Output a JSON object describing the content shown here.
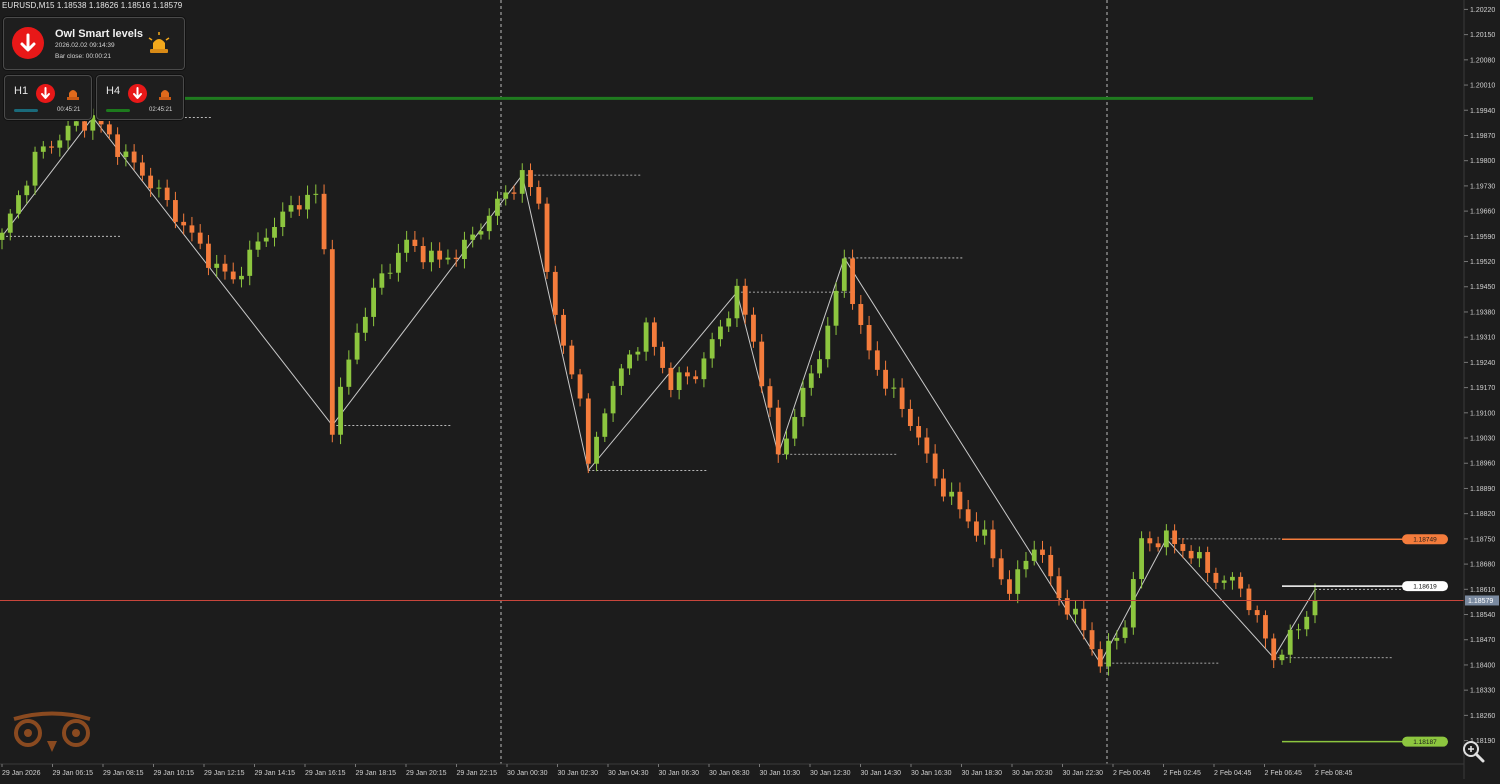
{
  "symbol_info": "EURUSD,M15  1.18538  1.18626  1.18516  1.18579",
  "indicator_panel": {
    "title": "Owl Smart levels",
    "datetime": "2026.02.02 09:14:39",
    "bar_close": "Bar close: 00:00:21",
    "signal": "down",
    "signal_color": "#e81818"
  },
  "timeframes": [
    {
      "label": "H1",
      "signal": "down",
      "time": "00:45:21",
      "bar_color": "#1a6a7a"
    },
    {
      "label": "H4",
      "signal": "down",
      "time": "02:45:21",
      "bar_color": "#1d7a1d"
    }
  ],
  "icons": {
    "main": "arrow-down-icon",
    "alarm": "alarm-siren-icon",
    "zoom": "magnifier-icon",
    "logo": "owl-logo-icon"
  },
  "colors": {
    "background": "#1c1c1c",
    "bull": "#8dc63f",
    "bear": "#f47c3c",
    "zigzag": "#e8e8e8",
    "bid_line": "#c8463c",
    "resistance": "#1f7a1f",
    "axis_text": "#d0d0d0"
  },
  "chart_data": {
    "type": "candlestick",
    "symbol": "EURUSD",
    "timeframe": "M15",
    "ohlc_last": {
      "open": 1.18538,
      "high": 1.18626,
      "low": 1.18516,
      "close": 1.18579
    },
    "y_axis": {
      "range": [
        1.18125,
        1.20235
      ],
      "ticks": [
        "1.20220",
        "1.20150",
        "1.20080",
        "1.20010",
        "1.19940",
        "1.19870",
        "1.19800",
        "1.19730",
        "1.19660",
        "1.19590",
        "1.19520",
        "1.19450",
        "1.19380",
        "1.19310",
        "1.19240",
        "1.19170",
        "1.19100",
        "1.19030",
        "1.18960",
        "1.18890",
        "1.18820",
        "1.18750",
        "1.18680",
        "1.18610",
        "1.18540",
        "1.18470",
        "1.18400",
        "1.18330",
        "1.18260",
        "1.18190"
      ]
    },
    "x_axis": {
      "ticks": [
        "29 Jan 2026",
        "29 Jan 06:15",
        "29 Jan 08:15",
        "29 Jan 10:15",
        "29 Jan 12:15",
        "29 Jan 14:15",
        "29 Jan 16:15",
        "29 Jan 18:15",
        "29 Jan 20:15",
        "29 Jan 22:15",
        "30 Jan 00:30",
        "30 Jan 02:30",
        "30 Jan 04:30",
        "30 Jan 06:30",
        "30 Jan 08:30",
        "30 Jan 10:30",
        "30 Jan 12:30",
        "30 Jan 14:30",
        "30 Jan 16:30",
        "30 Jan 18:30",
        "30 Jan 20:30",
        "30 Jan 22:30",
        "2 Feb 00:45",
        "2 Feb 02:45",
        "2 Feb 04:45",
        "2 Feb 06:45",
        "2 Feb 08:45"
      ]
    },
    "current_price": {
      "label": "1.18579",
      "value": 1.18579
    },
    "levels": [
      {
        "name": "resistance",
        "value": 1.19973,
        "color": "#1f7a1f",
        "label": ""
      },
      {
        "name": "upper-target",
        "value": 1.18749,
        "color": "#f47c3c",
        "label": "1.18749"
      },
      {
        "name": "entry",
        "value": 1.18619,
        "color": "#ffffff",
        "label": "1.18619"
      },
      {
        "name": "lower-target",
        "value": 1.18187,
        "color": "#8dc63f",
        "label": "1.18187"
      }
    ],
    "zigzag_pivots": [
      [
        0,
        1.1959
      ],
      [
        11,
        1.1992
      ],
      [
        40,
        1.19065
      ],
      [
        63,
        1.1976
      ],
      [
        71,
        1.1894
      ],
      [
        89,
        1.19435
      ],
      [
        94,
        1.18985
      ],
      [
        102,
        1.1953
      ],
      [
        133,
        1.18405
      ],
      [
        141,
        1.1875
      ],
      [
        154,
        1.1842
      ],
      [
        159,
        1.1861
      ]
    ],
    "candle_anchors": [
      [
        0,
        1.1959
      ],
      [
        4,
        1.1981
      ],
      [
        8,
        1.19885
      ],
      [
        11,
        1.1992
      ],
      [
        15,
        1.1981
      ],
      [
        18,
        1.1974
      ],
      [
        22,
        1.1962
      ],
      [
        26,
        1.195
      ],
      [
        28,
        1.1947
      ],
      [
        32,
        1.196
      ],
      [
        36,
        1.1969
      ],
      [
        38,
        1.197
      ],
      [
        39,
        1.1955
      ],
      [
        40,
        1.19065
      ],
      [
        43,
        1.1933
      ],
      [
        46,
        1.1948
      ],
      [
        49,
        1.1957
      ],
      [
        53,
        1.1952
      ],
      [
        56,
        1.1956
      ],
      [
        60,
        1.1968
      ],
      [
        63,
        1.1976
      ],
      [
        65,
        1.1968
      ],
      [
        67,
        1.1935
      ],
      [
        70,
        1.1915
      ],
      [
        71,
        1.1894
      ],
      [
        73,
        1.1912
      ],
      [
        76,
        1.1926
      ],
      [
        78,
        1.1933
      ],
      [
        81,
        1.1918
      ],
      [
        84,
        1.1921
      ],
      [
        86,
        1.1929
      ],
      [
        89,
        1.19435
      ],
      [
        91,
        1.193
      ],
      [
        94,
        1.18985
      ],
      [
        97,
        1.1915
      ],
      [
        100,
        1.1933
      ],
      [
        102,
        1.1953
      ],
      [
        104,
        1.1932
      ],
      [
        107,
        1.1918
      ],
      [
        110,
        1.1908
      ],
      [
        113,
        1.1892
      ],
      [
        116,
        1.1883
      ],
      [
        119,
        1.1875
      ],
      [
        122,
        1.186
      ],
      [
        125,
        1.1874
      ],
      [
        128,
        1.1859
      ],
      [
        131,
        1.185
      ],
      [
        133,
        1.18405
      ],
      [
        136,
        1.1852
      ],
      [
        138,
        1.1874
      ],
      [
        141,
        1.1875
      ],
      [
        144,
        1.1871
      ],
      [
        147,
        1.1864
      ],
      [
        150,
        1.1862
      ],
      [
        152,
        1.1852
      ],
      [
        154,
        1.1842
      ],
      [
        156,
        1.1847
      ],
      [
        159,
        1.18579
      ]
    ],
    "session_separators": [
      "30 Jan 00:30",
      "2 Feb 00:45"
    ]
  }
}
